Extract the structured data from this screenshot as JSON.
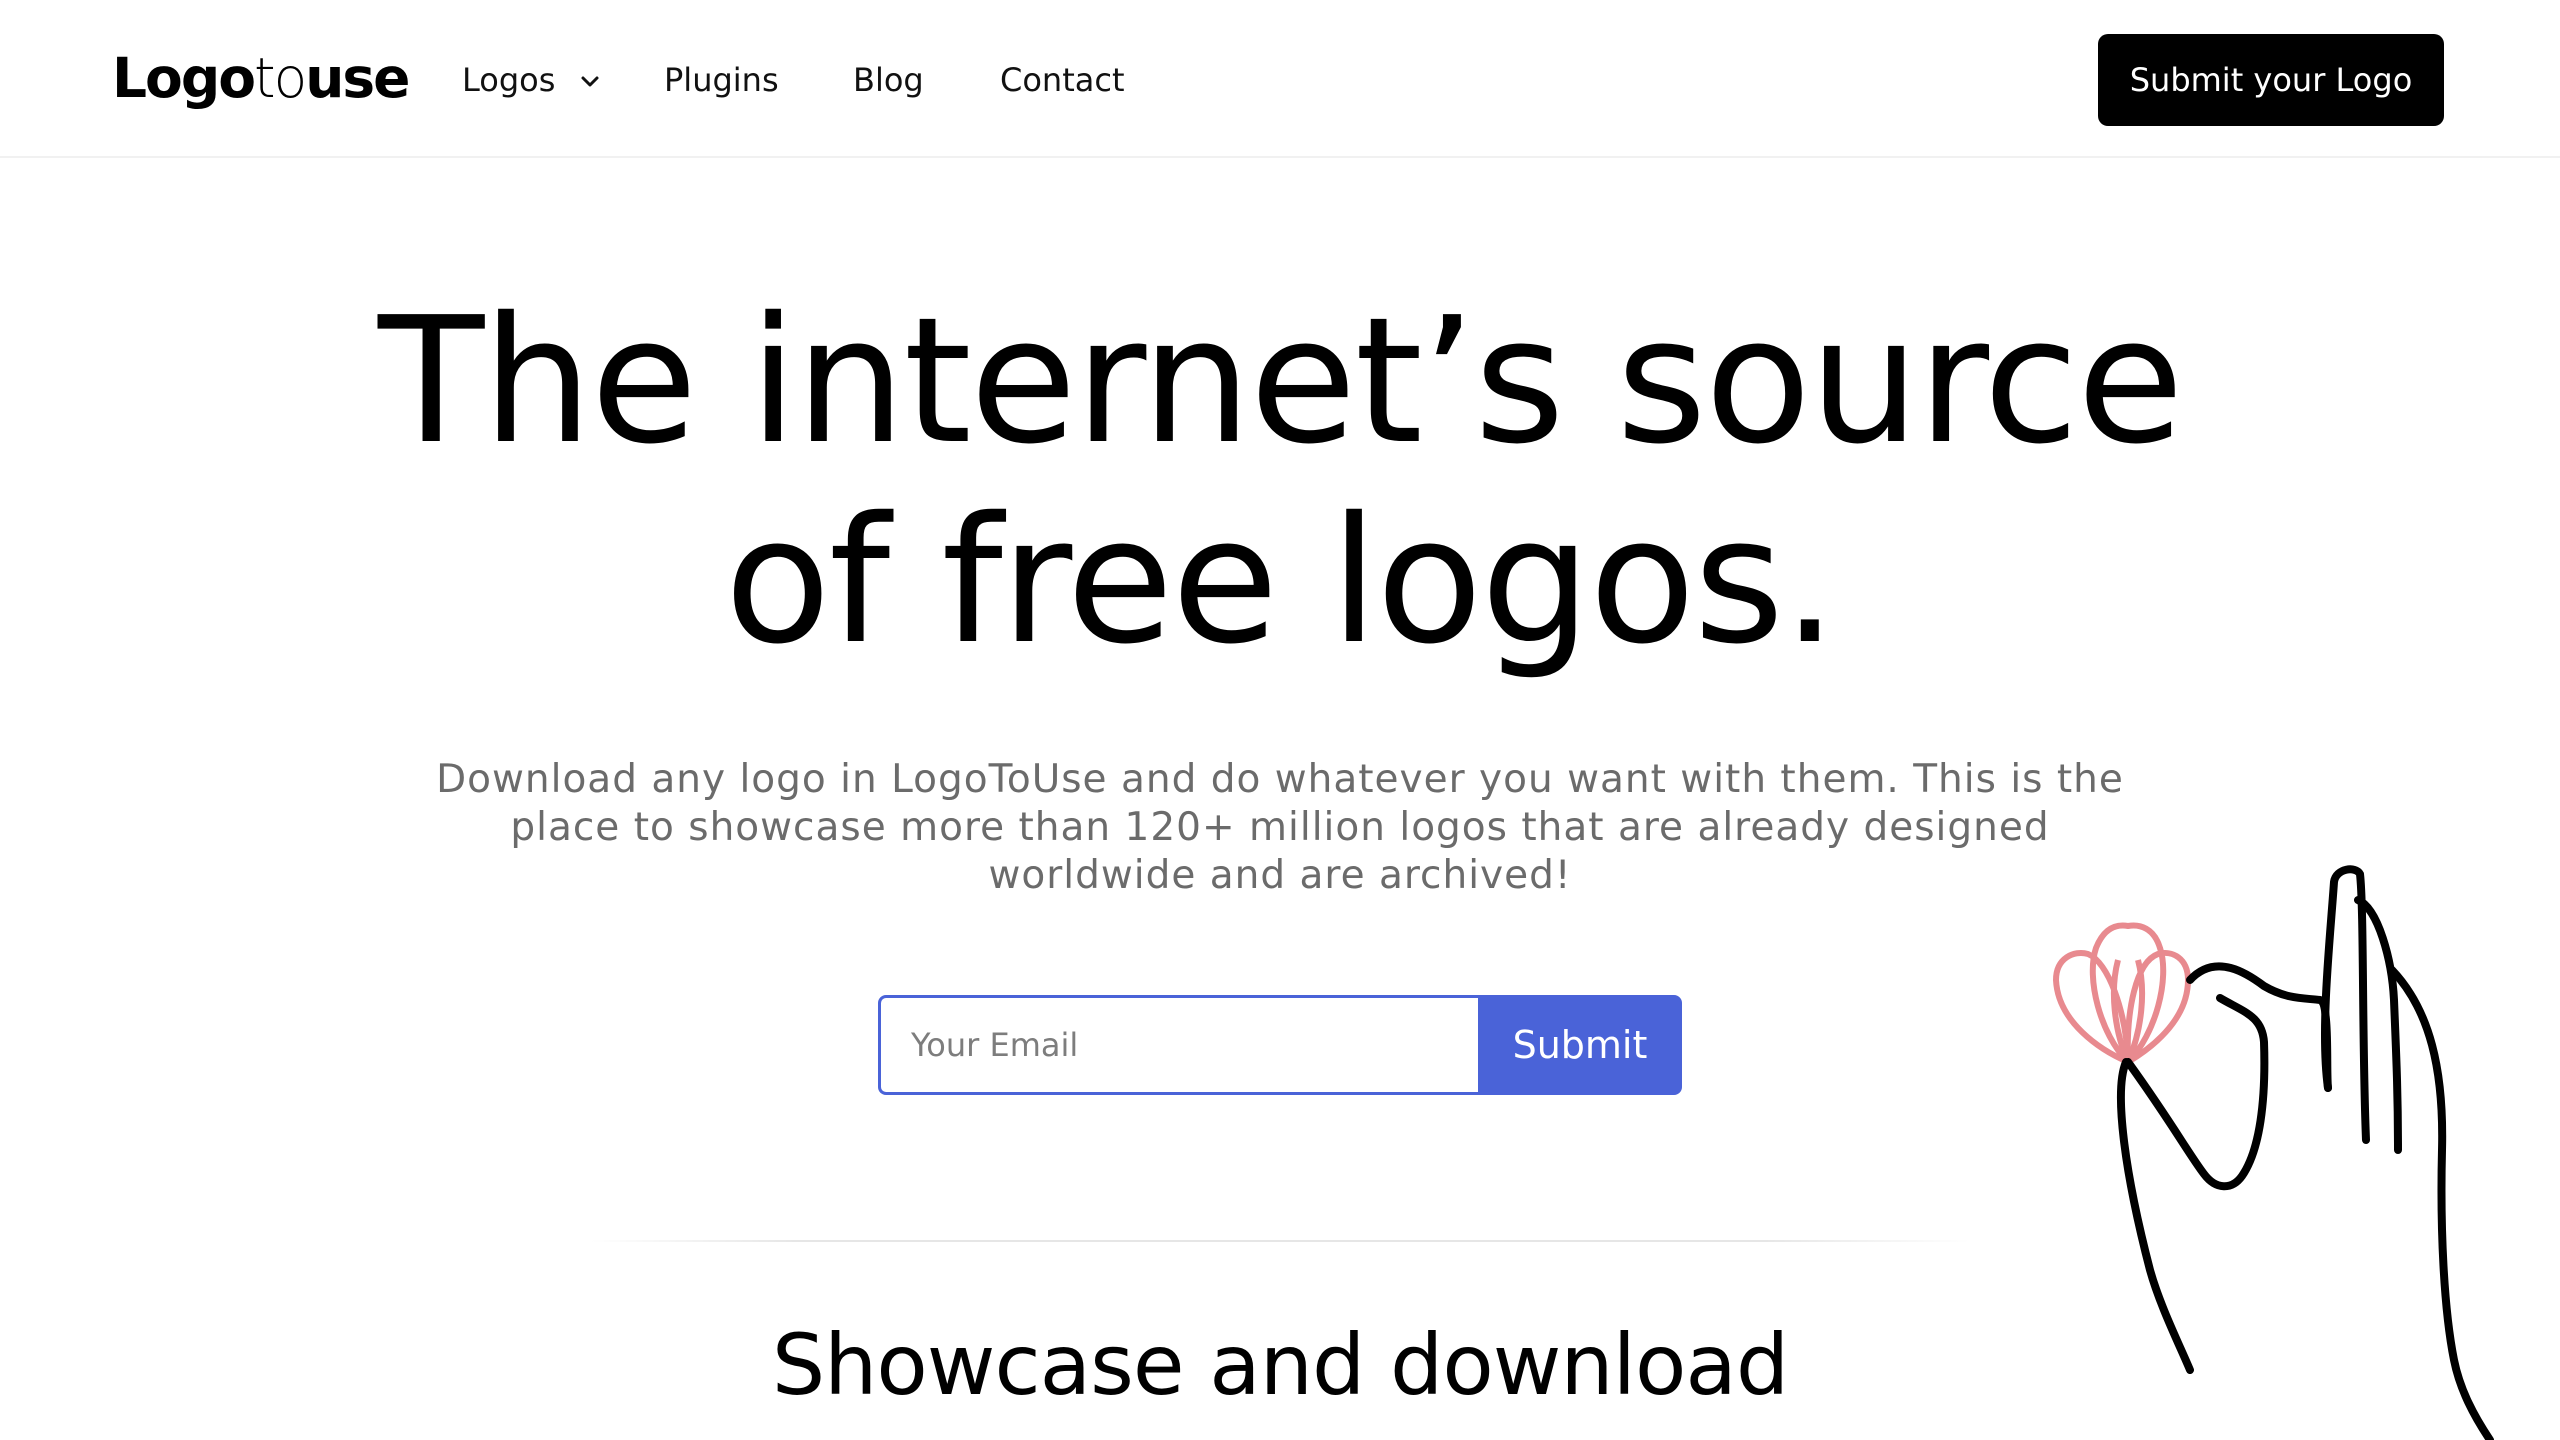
{
  "header": {
    "logo": {
      "bold": "Logo",
      "light": "to",
      "bold2": "use"
    },
    "nav": [
      {
        "label": "Logos",
        "has_dropdown": true
      },
      {
        "label": "Plugins"
      },
      {
        "label": "Blog"
      },
      {
        "label": "Contact"
      }
    ],
    "cta_label": "Submit your Logo"
  },
  "hero": {
    "title_line1": "The internet’s source",
    "title_line2": "of free logos.",
    "description": "Download any logo in LogoToUse and do whatever you want with them. This is the place to showcase more than 120+ million logos that are already designed worldwide and are archived!",
    "email_placeholder": "Your Email",
    "submit_label": "Submit"
  },
  "section": {
    "title": "Showcase and download"
  },
  "colors": {
    "accent": "#4a63d8",
    "flower": "#e88a8f",
    "text_muted": "#6b6b6b"
  },
  "icons": [
    "chevron-down-icon",
    "hand-flower-illustration"
  ]
}
